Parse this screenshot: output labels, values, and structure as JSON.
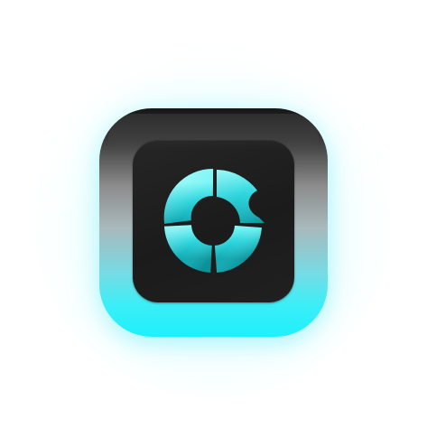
{
  "icon": {
    "name": "segmented-ring-app-icon",
    "colors": {
      "accent": "#1EF0FB",
      "accent_light": "#7AF6F6",
      "accent_dark": "#0FA9B3",
      "frame_top": "#161616",
      "frame_mid": "#A9B9BB",
      "frame_bottom": "#1EF0FB",
      "tile": "#1F1F1F"
    }
  }
}
